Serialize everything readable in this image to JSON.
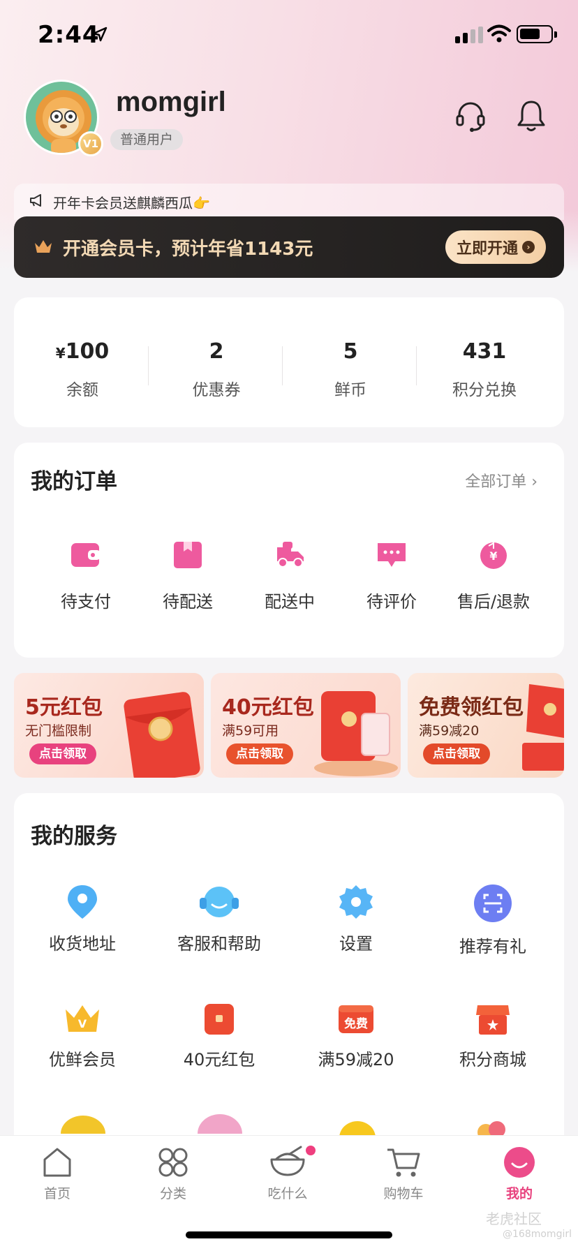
{
  "status_bar": {
    "time": "2:44"
  },
  "profile": {
    "username": "momgirl",
    "tag": "普通用户",
    "level": "V1"
  },
  "vip": {
    "notice": "开年卡会员送麒麟西瓜👉",
    "text": "开通会员卡，预计年省1143元",
    "button": "立即开通"
  },
  "stats": [
    {
      "value_prefix": "¥",
      "value": "100",
      "label": "余额"
    },
    {
      "value_prefix": "",
      "value": "2",
      "label": "优惠券"
    },
    {
      "value_prefix": "",
      "value": "5",
      "label": "鲜币"
    },
    {
      "value_prefix": "",
      "value": "431",
      "label": "积分兑换"
    }
  ],
  "orders": {
    "title": "我的订单",
    "all_link": "全部订单",
    "items": [
      {
        "label": "待支付",
        "icon": "wallet-icon"
      },
      {
        "label": "待配送",
        "icon": "package-icon"
      },
      {
        "label": "配送中",
        "icon": "delivery-truck-icon"
      },
      {
        "label": "待评价",
        "icon": "comment-icon"
      },
      {
        "label": "售后/退款",
        "icon": "refund-icon"
      }
    ]
  },
  "coupons": [
    {
      "title": "5元红包",
      "subtitle": "无门槛限制",
      "button": "点击领取"
    },
    {
      "title": "40元红包",
      "subtitle": "满59可用",
      "button": "点击领取"
    },
    {
      "title": "免费领红包",
      "subtitle": "满59减20",
      "button": "点击领取"
    }
  ],
  "services": {
    "title": "我的服务",
    "items": [
      {
        "label": "收货地址",
        "icon": "location-pin-icon"
      },
      {
        "label": "客服和帮助",
        "icon": "customer-service-icon"
      },
      {
        "label": "设置",
        "icon": "settings-gear-icon"
      },
      {
        "label": "推荐有礼",
        "icon": "scan-icon"
      },
      {
        "label": "优鲜会员",
        "icon": "vip-crown-icon"
      },
      {
        "label": "40元红包",
        "icon": "red-envelope-icon"
      },
      {
        "label": "满59减20",
        "icon": "free-badge-icon"
      },
      {
        "label": "积分商城",
        "icon": "shop-icon"
      }
    ]
  },
  "tabs": [
    {
      "label": "首页",
      "icon": "home-icon"
    },
    {
      "label": "分类",
      "icon": "category-grid-icon"
    },
    {
      "label": "吃什么",
      "icon": "bowl-icon"
    },
    {
      "label": "购物车",
      "icon": "cart-icon"
    },
    {
      "label": "我的",
      "icon": "profile-face-icon"
    }
  ],
  "watermark": {
    "text": "老虎社区",
    "handle": "@168momgirl"
  },
  "colors": {
    "accent": "#e8427e",
    "vip_gold": "#f3d9b5",
    "coupon_red": "#a8281e"
  }
}
